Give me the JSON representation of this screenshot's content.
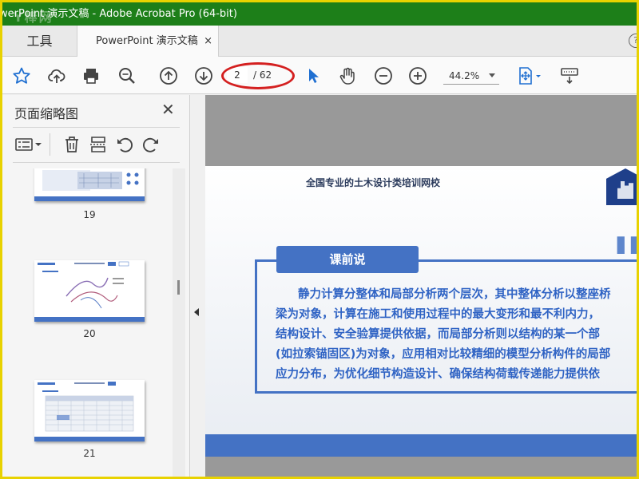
{
  "window": {
    "title": "werPoint 演示文稿 - Adobe Acrobat Pro (64-bit)",
    "watermark": "Y棒网"
  },
  "tabs": {
    "tools": "工具",
    "document": "PowerPoint 演示文稿",
    "close": "×",
    "help": "?"
  },
  "toolbar": {
    "current_page": "2",
    "total_pages": "/ 62",
    "zoom": "44.2%"
  },
  "sidebar": {
    "title": "页面缩略图",
    "close": "✕",
    "thumbnails": [
      {
        "label": "19"
      },
      {
        "label": "20"
      },
      {
        "label": "21"
      }
    ]
  },
  "slide": {
    "header": "全国专业的土木设计类培训网校",
    "tag": "课前说",
    "quote": "\"",
    "lines": [
      "静力计算分整体和局部分析两个层次，其中整体分析以整座桥",
      "梁为对象，计算在施工和使用过程中的最大变形和最不利内力，",
      "结构设计、安全验算提供依据，而局部分析则以结构的某一个部",
      "(如拉索锚固区)为对象，应用相对比较精细的模型分析构件的局部",
      "应力分布，为优化细节构造设计、确保结构荷载传递能力提供依"
    ]
  },
  "colors": {
    "titlebar": "#1d7f19",
    "accent": "#4472c4",
    "annotation": "#d42020",
    "frame": "#e8d200"
  }
}
